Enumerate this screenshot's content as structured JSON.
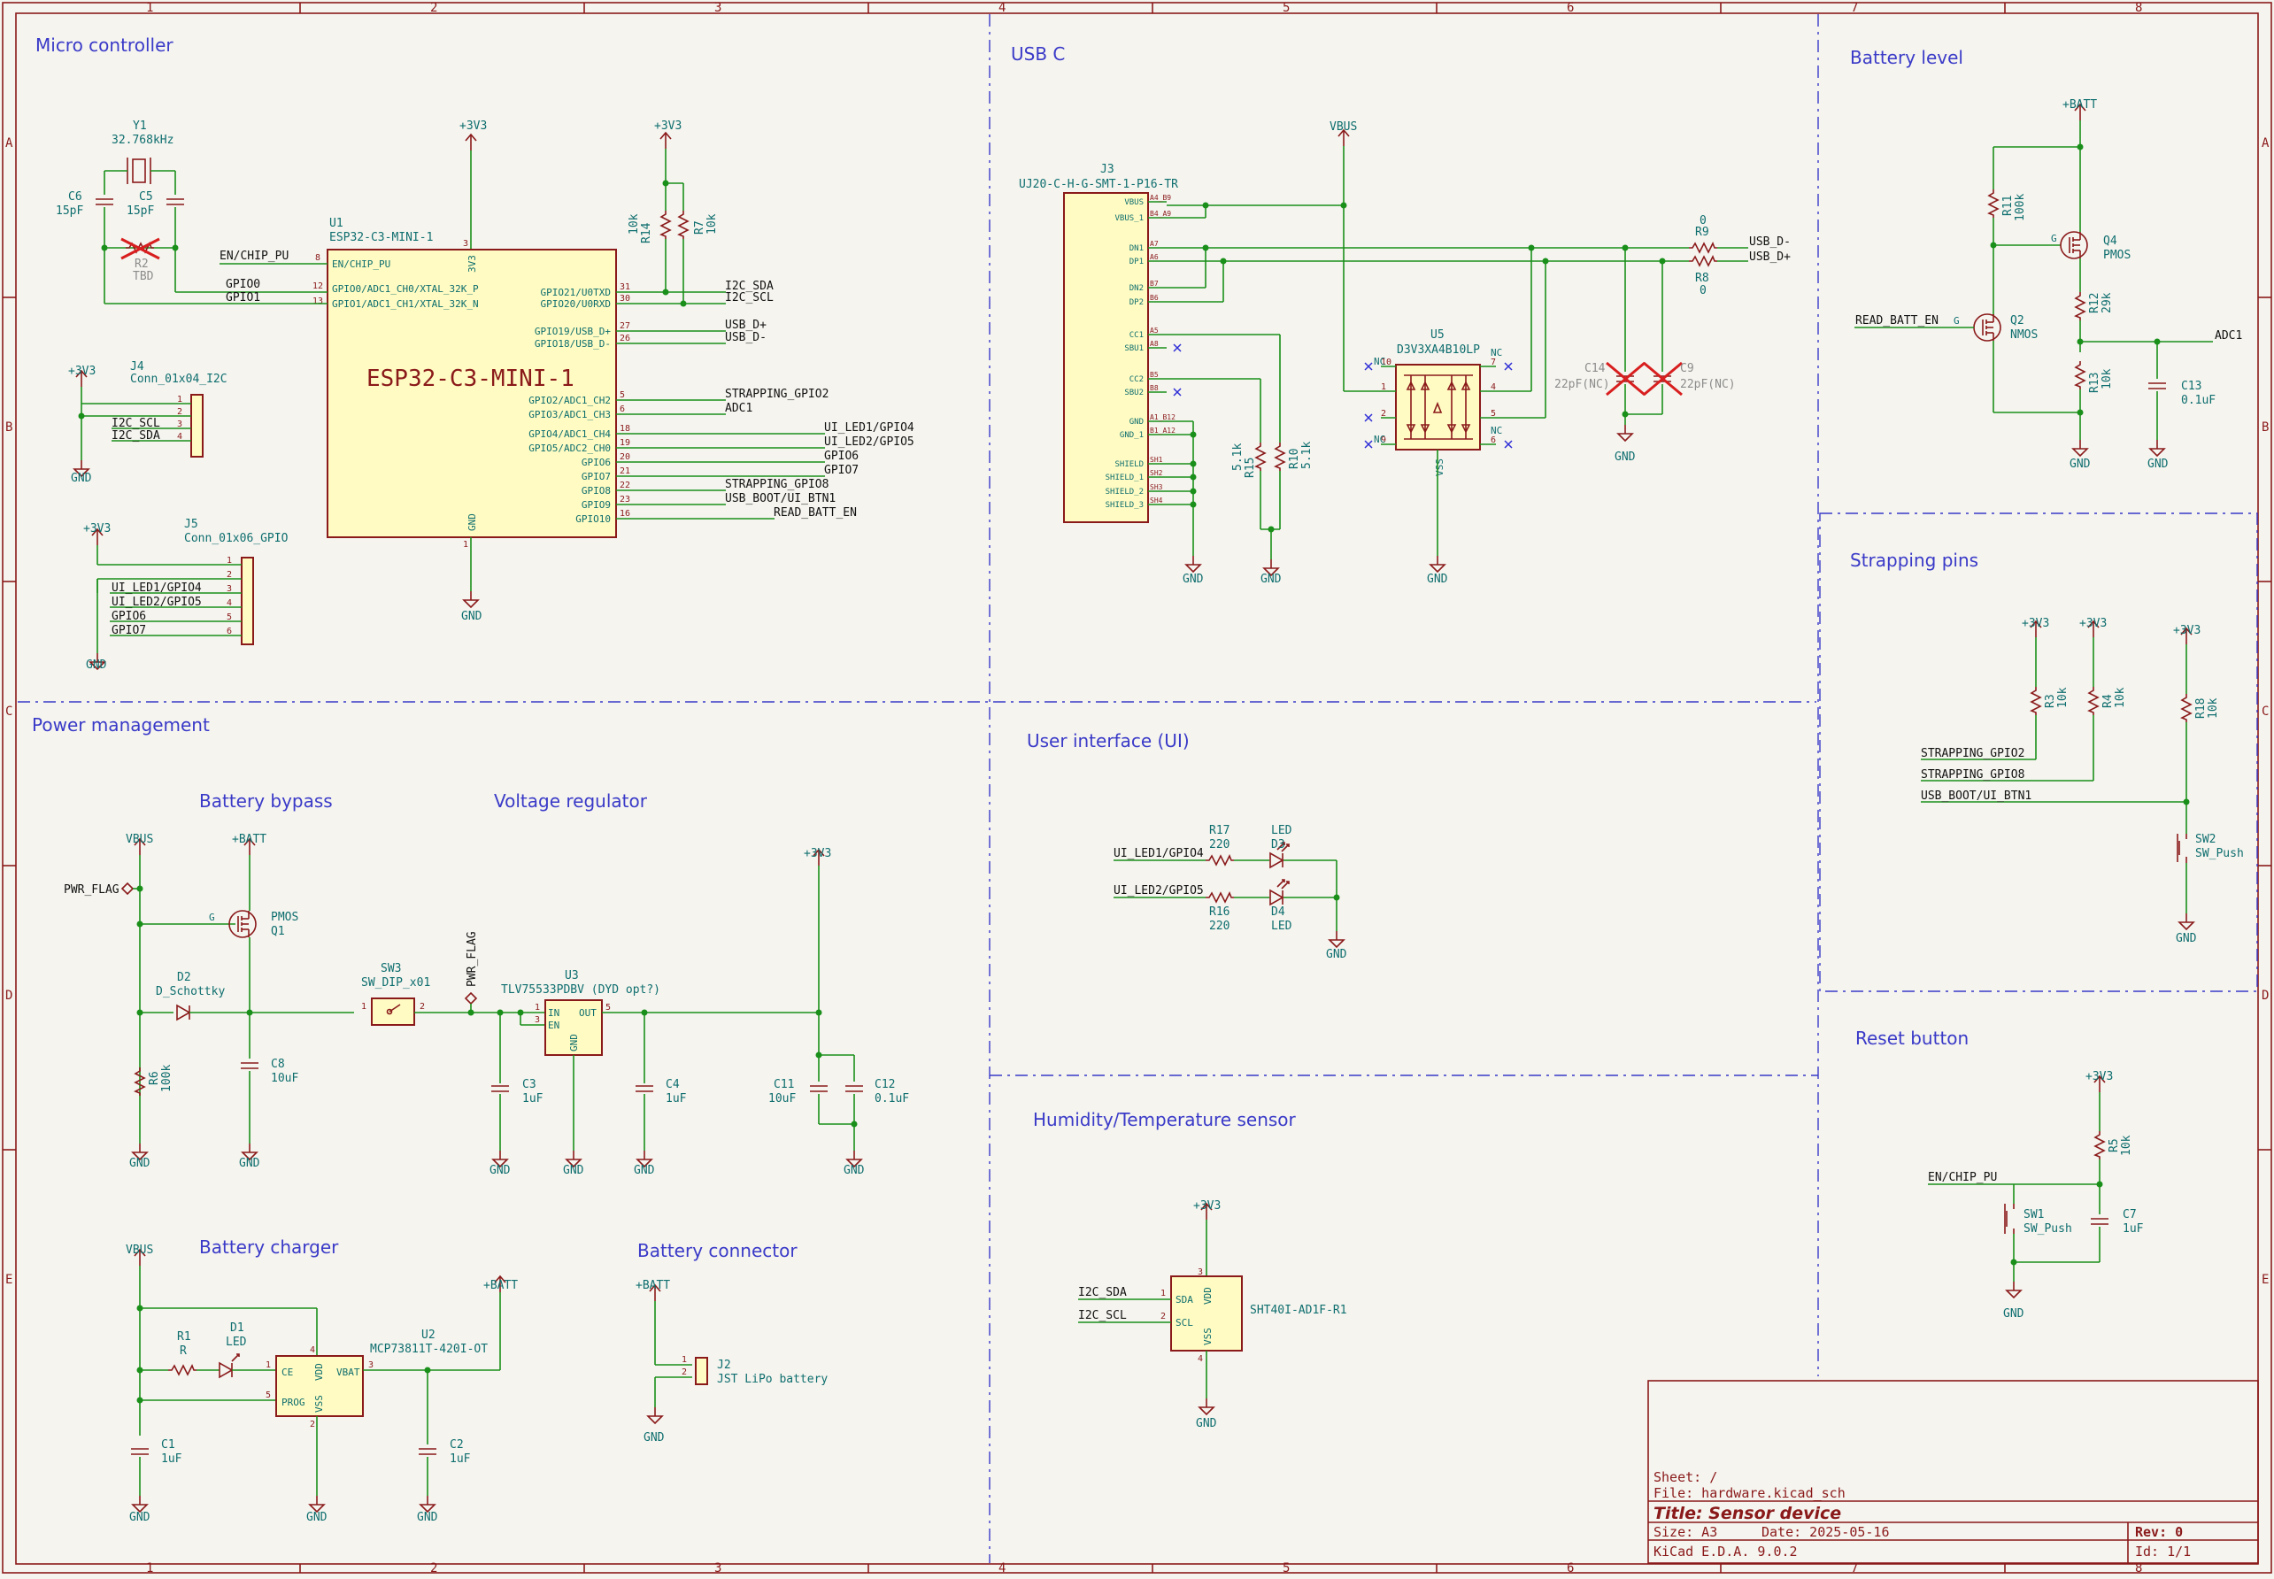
{
  "sections": {
    "micro": "Micro controller",
    "usb": "USB C",
    "battery_level": "Battery level",
    "strapping": "Strapping pins",
    "power": "Power management",
    "battery_bypass": "Battery bypass",
    "voltage_regulator": "Voltage regulator",
    "ui": "User interface (UI)",
    "reset": "Reset button",
    "humidity": "Humidity/Temperature sensor",
    "battery_charger": "Battery charger",
    "battery_connector": "Battery connector"
  },
  "frame": {
    "columns": [
      "1",
      "2",
      "3",
      "4",
      "5",
      "6",
      "7",
      "8"
    ],
    "rows": [
      "A",
      "B",
      "C",
      "D",
      "E"
    ]
  },
  "power": {
    "v33": "+3V3",
    "vbus": "VBUS",
    "batt": "+BATT",
    "gnd": "GND",
    "pwr_flag": "PWR_FLAG"
  },
  "mcu": {
    "ref": "U1",
    "value": "ESP32-C3-MINI-1",
    "big_label": "ESP32-C3-MINI-1",
    "pin_3v3": "3V3",
    "pin_gnd": "GND",
    "left_pins": [
      {
        "num": "8",
        "name": "EN/CHIP_PU"
      },
      {
        "num": "12",
        "name": "GPIO0/ADC1_CH0/XTAL_32K_P"
      },
      {
        "num": "13",
        "name": "GPIO1/ADC1_CH1/XTAL_32K_N"
      }
    ],
    "right_pins": [
      {
        "num": "31",
        "name": "GPIO21/U0TXD",
        "net": "I2C_SDA"
      },
      {
        "num": "30",
        "name": "GPIO20/U0RXD",
        "net": "I2C_SCL"
      },
      {
        "num": "27",
        "name": "GPIO19/USB_D+",
        "net": "USB_D+"
      },
      {
        "num": "26",
        "name": "GPIO18/USB_D-",
        "net": "USB_D-"
      },
      {
        "num": "5",
        "name": "GPIO2/ADC1_CH2",
        "net": "STRAPPING_GPIO2"
      },
      {
        "num": "6",
        "name": "GPIO3/ADC1_CH3",
        "net": "ADC1"
      },
      {
        "num": "18",
        "name": "GPIO4/ADC1_CH4",
        "net": "UI_LED1/GPIO4"
      },
      {
        "num": "19",
        "name": "GPIO5/ADC2_CH0",
        "net": "UI_LED2/GPIO5"
      },
      {
        "num": "20",
        "name": "GPIO6",
        "net": "GPIO6"
      },
      {
        "num": "21",
        "name": "GPIO7",
        "net": "GPIO7"
      },
      {
        "num": "22",
        "name": "GPIO8",
        "net": "STRAPPING_GPIO8"
      },
      {
        "num": "23",
        "name": "GPIO9",
        "net": "USB_BOOT/UI_BTN1"
      },
      {
        "num": "16",
        "name": "GPIO10",
        "net": "READ_BATT_EN"
      }
    ],
    "pin_3v3_num": "3",
    "pin_gnd_num": "1",
    "net_en": "EN/CHIP_PU",
    "net_gpio0": "GPIO0",
    "net_gpio1": "GPIO1"
  },
  "crystal": {
    "ref": "Y1",
    "value": "32.768kHz",
    "c6_ref": "C6",
    "c6_val": "15pF",
    "c5_ref": "C5",
    "c5_val": "15pF",
    "r2_ref": "R2",
    "r2_val": "TBD"
  },
  "pullups": {
    "r14_ref": "R14",
    "r14_val": "10k",
    "r7_ref": "R7",
    "r7_val": "10k"
  },
  "j4": {
    "ref": "J4",
    "value": "Conn_01x04_I2C",
    "pins": [
      "1",
      "2",
      "3",
      "4"
    ],
    "nets": [
      "",
      "",
      "I2C_SCL",
      "I2C_SDA"
    ]
  },
  "j5": {
    "ref": "J5",
    "value": "Conn_01x06_GPIO",
    "pins": [
      "1",
      "2",
      "3",
      "4",
      "5",
      "6"
    ],
    "nets": [
      "",
      "",
      "UI_LED1/GPIO4",
      "UI_LED2/GPIO5",
      "GPIO6",
      "GPIO7"
    ]
  },
  "usbc": {
    "ref": "J3",
    "value": "UJ20-C-H-G-SMT-1-P16-TR",
    "pins": [
      {
        "name": "VBUS",
        "num": "A4_B9"
      },
      {
        "name": "VBUS_1",
        "num": "B4_A9"
      },
      {
        "name": "DN1",
        "num": "A7"
      },
      {
        "name": "DP1",
        "num": "A6"
      },
      {
        "name": "DN2",
        "num": "B7"
      },
      {
        "name": "DP2",
        "num": "B6"
      },
      {
        "name": "CC1",
        "num": "A5"
      },
      {
        "name": "SBU1",
        "num": "A8"
      },
      {
        "name": "CC2",
        "num": "B5"
      },
      {
        "name": "SBU2",
        "num": "B8"
      },
      {
        "name": "GND",
        "num": "A1_B12"
      },
      {
        "name": "GND_1",
        "num": "B1_A12"
      },
      {
        "name": "SHIELD",
        "num": "SH1"
      },
      {
        "name": "SHIELD_1",
        "num": "SH2"
      },
      {
        "name": "SHIELD_2",
        "num": "SH3"
      },
      {
        "name": "SHIELD_3",
        "num": "SH4"
      }
    ],
    "r9_ref": "R9",
    "r9_val": "0",
    "r8_ref": "R8",
    "r8_val": "0",
    "net_dm": "USB_D-",
    "net_dp": "USB_D+",
    "r15_ref": "R15",
    "r15_val": "5.1k",
    "r10_ref": "R10",
    "r10_val": "5.1k",
    "esd_ref": "U5",
    "esd_val": "D3V3XA4B10LP",
    "esd_vss": "VSS",
    "esd_pins_left": [
      "10",
      "1",
      "2",
      "9"
    ],
    "esd_pins_right": [
      "7",
      "4",
      "5",
      "6"
    ],
    "nc": "NC",
    "c14_ref": "C14",
    "c14_val": "22pF(NC)",
    "c9_ref": "C9",
    "c9_val": "22pF(NC)"
  },
  "batlevel": {
    "r11_ref": "R11",
    "r11_val": "100k",
    "q4_ref": "Q4",
    "q4_val": "PMOS",
    "r12_ref": "R12",
    "r12_val": "29k",
    "r13_ref": "R13",
    "r13_val": "10k",
    "q2_ref": "Q2",
    "q2_val": "NMOS",
    "c13_ref": "C13",
    "c13_val": "0.1uF",
    "net_en": "READ_BATT_EN",
    "net_adc": "ADC1"
  },
  "strap": {
    "r3_ref": "R3",
    "r3_val": "10k",
    "r4_ref": "R4",
    "r4_val": "10k",
    "r18_ref": "R18",
    "r18_val": "10k",
    "net1": "STRAPPING_GPIO2",
    "net2": "STRAPPING_GPIO8",
    "net3": "USB_BOOT/UI_BTN1",
    "sw_ref": "SW2",
    "sw_val": "SW_Push"
  },
  "bypass": {
    "q1_ref": "Q1",
    "q1_val": "PMOS",
    "d2_ref": "D2",
    "d2_val": "D_Schottky",
    "r6_ref": "R6",
    "r6_val": "100k",
    "c8_ref": "C8",
    "c8_val": "10uF"
  },
  "regulator": {
    "sw3_ref": "SW3",
    "sw3_val": "SW_DIP_x01",
    "u3_ref": "U3",
    "u3_val": "TLV75533PDBV (DYD opt?)",
    "pin_in": "IN",
    "pin_en": "EN",
    "pin_out": "OUT",
    "pin_gnd": "GND",
    "c3_ref": "C3",
    "c3_val": "1uF",
    "c4_ref": "C4",
    "c4_val": "1uF",
    "c11_ref": "C11",
    "c11_val": "10uF",
    "c12_ref": "C12",
    "c12_val": "0.1uF"
  },
  "ui": {
    "net1": "UI_LED1/GPIO4",
    "net2": "UI_LED2/GPIO5",
    "r17_ref": "R17",
    "r17_val": "220",
    "r16_ref": "R16",
    "r16_val": "220",
    "d3_ref": "D3",
    "d3_val": "LED",
    "d4_ref": "D4",
    "d4_val": "LED"
  },
  "reset": {
    "r5_ref": "R5",
    "r5_val": "10k",
    "net": "EN/CHIP_PU",
    "sw_ref": "SW1",
    "sw_val": "SW_Push",
    "c7_ref": "C7",
    "c7_val": "1uF"
  },
  "sensor": {
    "ref": "SHT40I-AD1F-R1",
    "net_sda": "I2C_SDA",
    "net_scl": "I2C_SCL",
    "pin_sda": "SDA",
    "pin_scl": "SCL",
    "pin_vdd": "VDD",
    "pin_vss": "VSS"
  },
  "charger": {
    "r1_ref": "R1",
    "r1_val": "R",
    "d1_ref": "D1",
    "d1_val": "LED",
    "u2_ref": "U2",
    "u2_val": "MCP73811T-420I-OT",
    "pin_ce": "CE",
    "pin_prog": "PROG",
    "pin_vdd": "VDD",
    "pin_vss": "VSS",
    "pin_vbat": "VBAT",
    "c1_ref": "C1",
    "c1_val": "1uF",
    "c2_ref": "C2",
    "c2_val": "1uF"
  },
  "connector": {
    "ref": "J2",
    "value": "JST LiPo battery"
  },
  "titleblock": {
    "sheet": "Sheet: /",
    "file": "File: hardware.kicad_sch",
    "title": "Title: Sensor device",
    "size": "Size: A3",
    "date": "Date: 2025-05-16",
    "rev": "Rev: 0",
    "tool": "KiCad E.D.A. 9.0.2",
    "id": "Id: 1/1"
  }
}
